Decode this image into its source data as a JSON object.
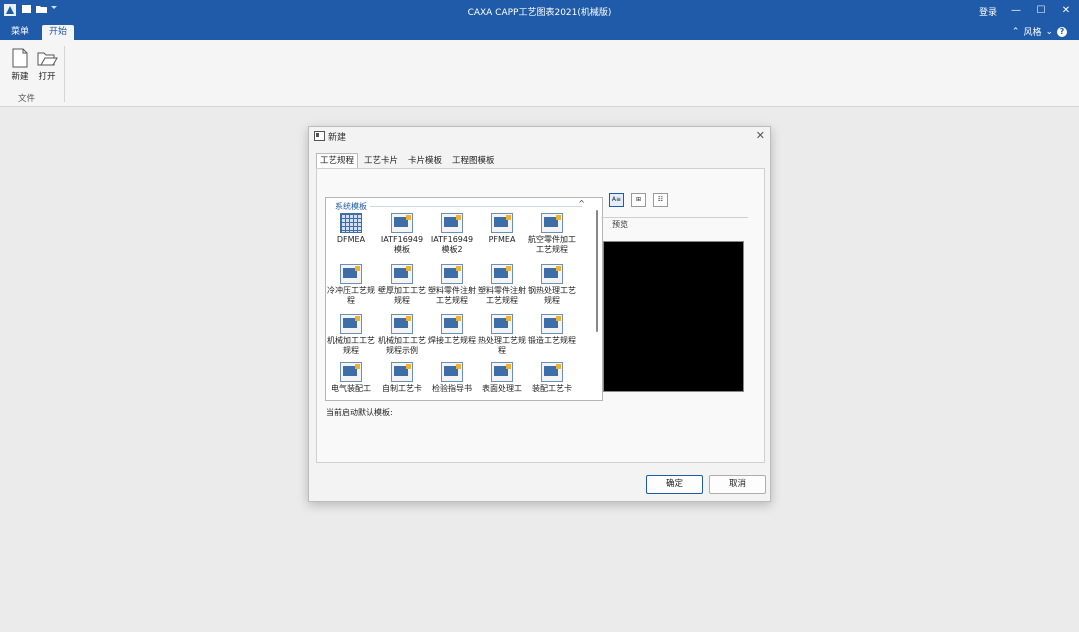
{
  "window": {
    "title": "CAXA CAPP工艺图表2021(机械版)",
    "login_label": "登录",
    "minimize": "—",
    "maximize": "☐",
    "close": "✕"
  },
  "ribbon_tabs": [
    {
      "label": "菜单",
      "active": false
    },
    {
      "label": "开始",
      "active": true
    }
  ],
  "style_menu": {
    "label": "风格",
    "help": "?"
  },
  "ribbon": {
    "new_label": "新建",
    "open_label": "打开",
    "group_label": "文件"
  },
  "dialog": {
    "title": "新建",
    "close": "✕",
    "tabs": [
      {
        "label": "工艺规程",
        "active": true
      },
      {
        "label": "工艺卡片",
        "active": false
      },
      {
        "label": "卡片模板",
        "active": false
      },
      {
        "label": "工程图模板",
        "active": false
      }
    ],
    "group_header": "系统模板",
    "collapse": "^",
    "templates": [
      {
        "label": "DFMEA",
        "icon": "grid-icon"
      },
      {
        "label": "IATF16949模板",
        "icon": "template-icon"
      },
      {
        "label": "IATF16949模板2",
        "icon": "template-icon"
      },
      {
        "label": "PFMEA",
        "icon": "template-icon"
      },
      {
        "label": "航空零件加工工艺规程",
        "icon": "template-icon"
      },
      {
        "label": "冷冲压工艺规程",
        "icon": "template-icon"
      },
      {
        "label": "壁厚加工工艺规程",
        "icon": "template-icon"
      },
      {
        "label": "塑料零件注射工艺规程",
        "icon": "template-icon"
      },
      {
        "label": "塑料零件注射工艺规程",
        "icon": "template-icon"
      },
      {
        "label": "钢热处理工艺规程",
        "icon": "template-icon"
      },
      {
        "label": "机械加工工艺规程",
        "icon": "template-icon"
      },
      {
        "label": "机械加工工艺规程示例",
        "icon": "template-icon"
      },
      {
        "label": "焊接工艺规程",
        "icon": "template-icon"
      },
      {
        "label": "热处理工艺规程",
        "icon": "template-icon"
      },
      {
        "label": "锻造工艺规程",
        "icon": "template-icon"
      },
      {
        "label": "电气装配工",
        "icon": "template-icon"
      },
      {
        "label": "自制工艺卡",
        "icon": "template-icon"
      },
      {
        "label": "检验指导书",
        "icon": "template-icon"
      },
      {
        "label": "表面处理工",
        "icon": "template-icon"
      },
      {
        "label": "装配工艺卡",
        "icon": "template-icon"
      }
    ],
    "status_text": "当前启动默认模板:",
    "view_buttons": [
      {
        "label": "A≡",
        "icon": "large-icon-view-icon"
      },
      {
        "label": "⊞",
        "icon": "small-icon-view-icon"
      },
      {
        "label": "☷",
        "icon": "list-view-icon"
      }
    ],
    "preview_label": "预览",
    "ok_label": "确定",
    "cancel_label": "取消"
  },
  "colors": {
    "accent": "#1f5ba8",
    "preview": "#000000"
  }
}
